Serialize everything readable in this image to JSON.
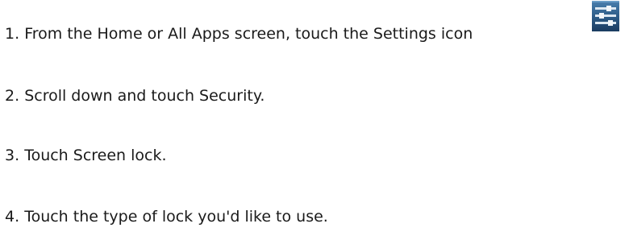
{
  "steps": [
    {
      "number": "1.",
      "text": "From the Home or All Apps screen, touch the Settings icon"
    },
    {
      "number": "2.",
      "text": "Scroll down and touch Security."
    },
    {
      "number": "3.",
      "text": "Touch Screen lock."
    },
    {
      "number": "4.",
      "text": "Touch the type of lock you'd like to use."
    }
  ],
  "icons": {
    "settings": "settings-icon"
  },
  "colors": {
    "text": "#1a1a1a",
    "icon_bg_top": "#3d6f9e",
    "icon_bg_bottom": "#1d3f66",
    "icon_bars": "#e6eef5"
  }
}
